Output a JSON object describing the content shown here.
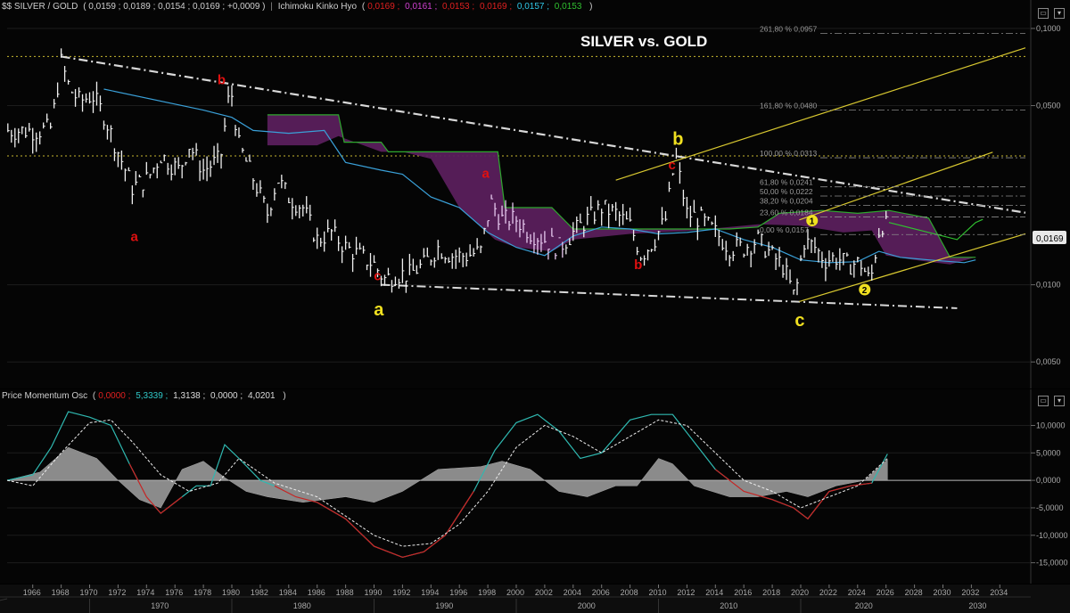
{
  "main_header": {
    "symbol": "$$ SILVER / GOLD",
    "ohlc": "( 0,0159 ; 0,0189 ; 0,0154 ; 0,0169 ; +0,0009 )",
    "indicator": "Ichimoku Kinko Hyo",
    "ichimoku_values": [
      "0,0169",
      "0,0161",
      "0,0153",
      "0,0169",
      "0,0157",
      "0,0153"
    ],
    "ichimoku_colors": [
      "#e02020",
      "#d040d0",
      "#e02020",
      "#e02020",
      "#30c8e8",
      "#30c030"
    ]
  },
  "osc_header": {
    "indicator": "Price Momentum Osc",
    "values": [
      "0,0000",
      "5,3339",
      "1,3138",
      "0,0000",
      "4,0201"
    ],
    "colors": [
      "#e02020",
      "#30c8c8",
      "#dddddd",
      "#dddddd",
      "#dddddd"
    ]
  },
  "title": "SILVER vs. GOLD",
  "last_price_label": "0,0169",
  "fib_levels": [
    {
      "label": "261,80 % 0,0957",
      "value": 0.0957
    },
    {
      "label": "161,80 % 0,0480",
      "value": 0.048
    },
    {
      "label": "100,00 % 0,0313",
      "value": 0.0313
    },
    {
      "label": "61,80 % 0,0241",
      "value": 0.0241
    },
    {
      "label": "50,00 % 0,0222",
      "value": 0.0222
    },
    {
      "label": "38,20 % 0,0204",
      "value": 0.0204
    },
    {
      "label": "23,60 % 0,0184",
      "value": 0.0184
    },
    {
      "label": "0,00 % 0,0157",
      "value": 0.0157
    }
  ],
  "wave_labels": [
    {
      "text": "a",
      "color": "#e01010",
      "year": 1973.2,
      "value": 0.0148
    },
    {
      "text": "b",
      "color": "#e01010",
      "year": 1979.3,
      "value": 0.0605
    },
    {
      "text": "c",
      "color": "#e01010",
      "year": 1990.3,
      "value": 0.0104
    },
    {
      "text": "a",
      "color": "#f0e020",
      "year": 1990.3,
      "value": 0.0076
    },
    {
      "text": "a",
      "color": "#e01010",
      "year": 1997.9,
      "value": 0.0262
    },
    {
      "text": "b",
      "color": "#e01010",
      "year": 2008.6,
      "value": 0.0115
    },
    {
      "text": "b",
      "color": "#f0e020",
      "year": 2011.3,
      "value": 0.0352
    },
    {
      "text": "c",
      "color": "#e01010",
      "year": 2011.0,
      "value": 0.0282
    },
    {
      "text": "c",
      "color": "#f0e020",
      "year": 2019.9,
      "value": 0.0069
    },
    {
      "text": "1",
      "color": "#f0e020",
      "year": 2020.8,
      "value": 0.0171,
      "circled": true
    },
    {
      "text": "2",
      "color": "#f0e020",
      "year": 2024.5,
      "value": 0.0092,
      "circled": true
    }
  ],
  "price_axis": {
    "ticks": [
      {
        "label": "0,1000",
        "value": 0.1
      },
      {
        "label": "0,0500",
        "value": 0.05
      },
      {
        "label": "0,0100",
        "value": 0.01
      },
      {
        "label": "0,0050",
        "value": 0.005
      }
    ],
    "scale": "log",
    "range": [
      0.0042,
      0.11
    ]
  },
  "osc_axis": {
    "ticks": [
      {
        "label": "10,0000",
        "value": 10
      },
      {
        "label": "5,0000",
        "value": 5
      },
      {
        "label": "0,0000",
        "value": 0
      },
      {
        "label": "-5,0000",
        "value": -5
      },
      {
        "label": "-10,0000",
        "value": -10
      },
      {
        "label": "-15,0000",
        "value": -15
      }
    ],
    "range": [
      -17.5,
      13
    ]
  },
  "time_axis": {
    "years": [
      "1966",
      "1968",
      "1970",
      "1972",
      "1974",
      "1976",
      "1978",
      "1980",
      "1982",
      "1984",
      "1986",
      "1988",
      "1990",
      "1992",
      "1994",
      "1996",
      "1998",
      "2000",
      "2002",
      "2004",
      "2006",
      "2008",
      "2010",
      "2012",
      "2014",
      "2016",
      "2018",
      "2020",
      "2022",
      "2024",
      "2026",
      "2028",
      "2030",
      "2032",
      "2034"
    ],
    "decades": [
      {
        "label": "1960",
        "year": 1961
      },
      {
        "label": "1970",
        "year": 1975
      },
      {
        "label": "1980",
        "year": 1985
      },
      {
        "label": "1990",
        "year": 1995
      },
      {
        "label": "2000",
        "year": 2005
      },
      {
        "label": "2010",
        "year": 2015
      },
      {
        "label": "2020",
        "year": 2024.5
      },
      {
        "label": "2030",
        "year": 2032.5
      }
    ],
    "range": [
      1964.2,
      2035.8
    ]
  },
  "chart_data": [
    {
      "type": "line",
      "title": "SILVER vs. GOLD",
      "yscale": "log",
      "ylim": [
        0.0042,
        0.11
      ],
      "xlim": [
        1964.2,
        2035.8
      ],
      "series": [
        {
          "name": "$$ SILVER / GOLD",
          "x": [
            1964.2,
            1966.5,
            1967.3,
            1968.0,
            1968.6,
            1969.3,
            1970.2,
            1971.0,
            1972.0,
            1973.0,
            1974.1,
            1975.0,
            1976.3,
            1977.0,
            1978.0,
            1979.2,
            1979.9,
            1980.5,
            1981.5,
            1982.5,
            1983.2,
            1984.0,
            1985.0,
            1986.0,
            1987.0,
            1988.0,
            1989.0,
            1990.0,
            1990.7,
            1991.5,
            1992.5,
            1993.5,
            1994.5,
            1995.5,
            1996.5,
            1997.5,
            1998.2,
            1999.0,
            2000.0,
            2001.0,
            2002.0,
            2003.0,
            2004.0,
            2005.0,
            2006.0,
            2007.0,
            2008.0,
            2008.8,
            2009.7,
            2010.5,
            2011.2,
            2012.0,
            2013.0,
            2014.0,
            2015.0,
            2016.0,
            2017.0,
            2018.0,
            2018.8,
            2019.6,
            2020.2,
            2020.9,
            2021.7,
            2022.5,
            2023.3,
            2024.2,
            2024.9,
            2025.6,
            2026.1
          ],
          "values": [
            0.04,
            0.04,
            0.041,
            0.074,
            0.058,
            0.052,
            0.055,
            0.046,
            0.033,
            0.024,
            0.026,
            0.032,
            0.028,
            0.035,
            0.028,
            0.031,
            0.06,
            0.035,
            0.026,
            0.019,
            0.026,
            0.022,
            0.02,
            0.015,
            0.016,
            0.014,
            0.013,
            0.012,
            0.0105,
            0.011,
            0.011,
            0.012,
            0.014,
            0.013,
            0.013,
            0.0135,
            0.021,
            0.018,
            0.018,
            0.016,
            0.015,
            0.014,
            0.016,
            0.018,
            0.02,
            0.019,
            0.017,
            0.013,
            0.015,
            0.018,
            0.032,
            0.019,
            0.018,
            0.016,
            0.014,
            0.014,
            0.015,
            0.013,
            0.0118,
            0.0088,
            0.0148,
            0.0142,
            0.0125,
            0.0128,
            0.012,
            0.0122,
            0.0102,
            0.0175,
            0.0169
          ]
        }
      ]
    },
    {
      "type": "line",
      "title": "Price Momentum Osc",
      "ylim": [
        -17.5,
        13
      ],
      "xlim": [
        1964.2,
        2035.8
      ],
      "series": [
        {
          "name": "Price Momentum Osc (5,3339)",
          "x": [
            1964.2,
            1966.0,
            1967.3,
            1968.5,
            1970.0,
            1971.5,
            1972.8,
            1974.0,
            1975.0,
            1976.5,
            1977.5,
            1978.5,
            1979.5,
            1980.5,
            1982.0,
            1983.0,
            1984.5,
            1986.0,
            1988.0,
            1990.0,
            1992.0,
            1993.5,
            1995.0,
            1997.0,
            1998.5,
            2000.0,
            2001.5,
            2003.0,
            2004.5,
            2006.0,
            2008.0,
            2009.5,
            2011.0,
            2012.5,
            2014.0,
            2016.0,
            2018.0,
            2019.5,
            2020.5,
            2022.0,
            2023.5,
            2025.0,
            2026.1
          ],
          "values": [
            0,
            1,
            6,
            12.5,
            11.5,
            10,
            3,
            -3,
            -6,
            -3,
            -1,
            -1,
            6.5,
            4,
            0,
            -1,
            -3,
            -4,
            -7,
            -12,
            -14,
            -13,
            -10,
            -2,
            5.5,
            10.5,
            12,
            9,
            4,
            5,
            11,
            12,
            12,
            7,
            2,
            -2,
            -3.5,
            -5,
            -7,
            -2,
            -1,
            -0.5,
            4.8
          ]
        },
        {
          "name": "Signal (1,3138)",
          "x": [
            1964.2,
            1966.0,
            1968.0,
            1970.0,
            1971.5,
            1973.0,
            1975.0,
            1977.0,
            1979.0,
            1980.5,
            1983.0,
            1986.0,
            1988.0,
            1990.0,
            1992.0,
            1994.0,
            1996.0,
            1998.0,
            2000.0,
            2002.0,
            2004.0,
            2006.0,
            2008.0,
            2010.0,
            2012.0,
            2014.0,
            2016.0,
            2018.0,
            2020.0,
            2022.0,
            2024.0,
            2026.1
          ],
          "values": [
            0,
            -1,
            5,
            10.5,
            11,
            7,
            1,
            -2,
            -0.5,
            4,
            -0.5,
            -3,
            -6.5,
            -10,
            -12,
            -11.5,
            -8,
            -2,
            6,
            10,
            8,
            5,
            8,
            11,
            10,
            5,
            0,
            -2,
            -5,
            -3,
            -1,
            4
          ]
        },
        {
          "name": "Histogram (4,0201)",
          "x": [
            1964.2,
            1966.5,
            1968.5,
            1970.5,
            1972.0,
            1973.5,
            1975.0,
            1976.5,
            1978.0,
            1979.5,
            1981.0,
            1982.5,
            1985.0,
            1988.0,
            1990.0,
            1992.0,
            1994.5,
            1997.5,
            1999.0,
            2001.0,
            2003.0,
            2005.0,
            2007.0,
            2008.5,
            2010.0,
            2011.0,
            2012.5,
            2015.0,
            2017.0,
            2019.0,
            2020.5,
            2022.5,
            2024.5,
            2026.1
          ],
          "values": [
            0,
            1.5,
            6,
            4,
            0,
            -3.5,
            -5,
            2,
            3.5,
            0.5,
            -2,
            -3,
            -4,
            -3,
            -4,
            -2,
            2,
            2.5,
            3.5,
            2,
            -2,
            -3,
            -1,
            -1,
            4,
            3,
            -1,
            -3,
            -3,
            -2,
            -3,
            -1,
            0,
            3.8
          ]
        }
      ]
    }
  ]
}
